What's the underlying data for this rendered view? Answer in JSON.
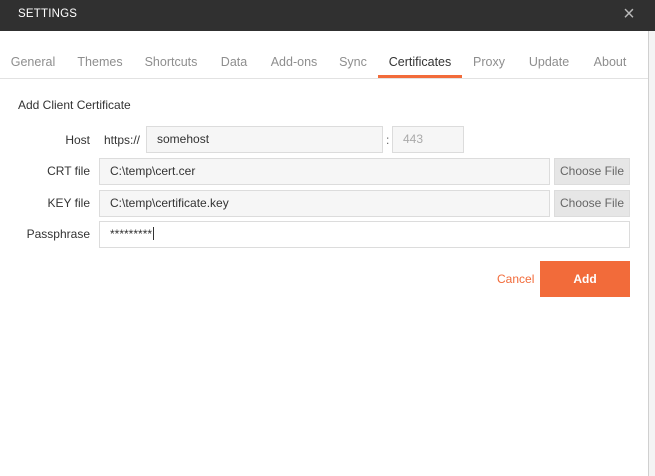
{
  "window": {
    "title": "SETTINGS",
    "close_glyph": "×"
  },
  "tabs": [
    {
      "label": "General"
    },
    {
      "label": "Themes"
    },
    {
      "label": "Shortcuts"
    },
    {
      "label": "Data"
    },
    {
      "label": "Add-ons"
    },
    {
      "label": "Sync"
    },
    {
      "label": "Certificates",
      "active": true
    },
    {
      "label": "Proxy"
    },
    {
      "label": "Update"
    },
    {
      "label": "About"
    }
  ],
  "form": {
    "heading": "Add Client Certificate",
    "host": {
      "label": "Host",
      "prefix": "https://",
      "value": "somehost",
      "separator": ":",
      "port_placeholder": "443"
    },
    "crt": {
      "label": "CRT file",
      "value": "C:\\temp\\cert.cer",
      "button": "Choose File"
    },
    "key": {
      "label": "KEY file",
      "value": "C:\\temp\\certificate.key",
      "button": "Choose File"
    },
    "passphrase": {
      "label": "Passphrase",
      "value": "*********"
    },
    "cancel_label": "Cancel",
    "add_label": "Add"
  },
  "colors": {
    "accent": "#f26b3a",
    "titlebar": "#303030"
  }
}
